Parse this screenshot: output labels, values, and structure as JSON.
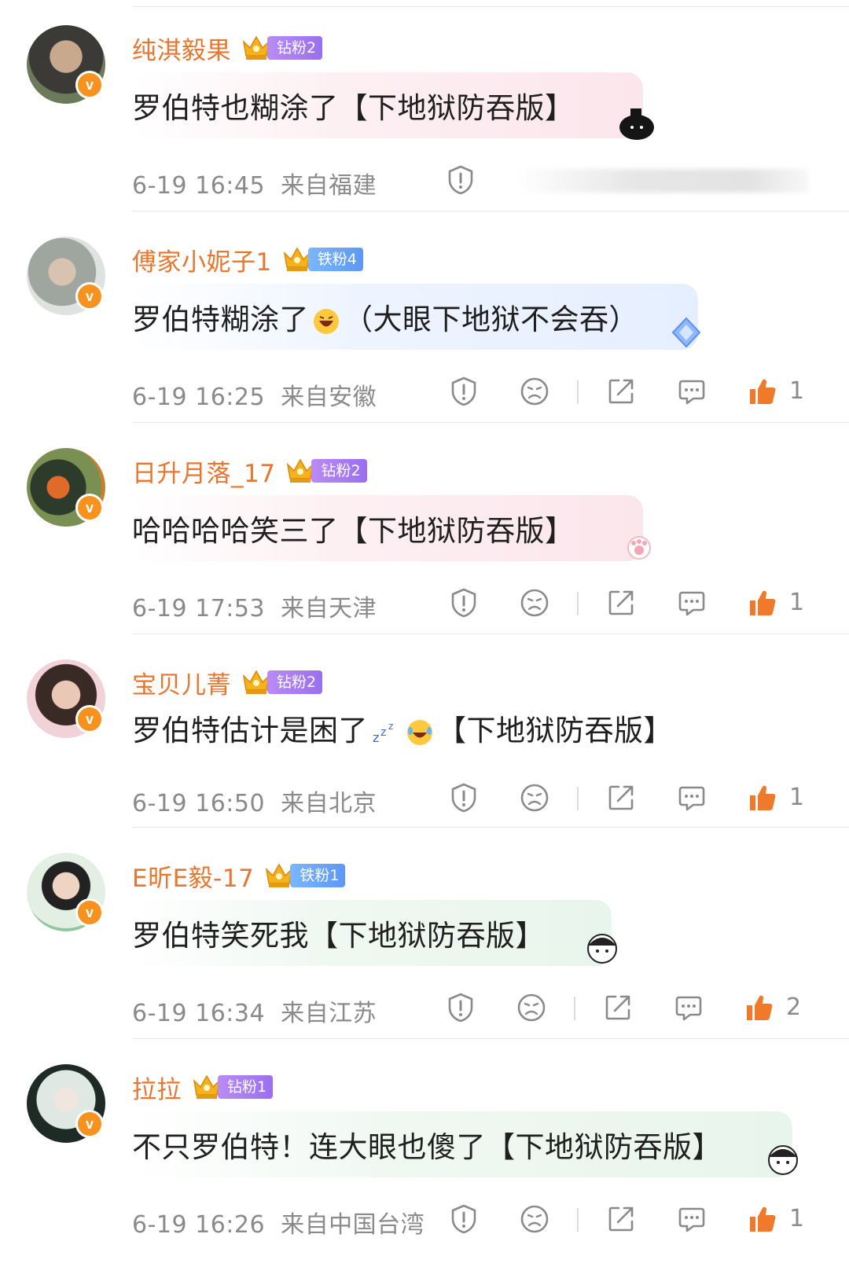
{
  "comments": [
    {
      "username": "纯淇毅果",
      "fan_badge": "钻粉2",
      "text": "罗伯特也糊涂了【下地狱防吞版】",
      "time": "6-19 16:45",
      "location": "来自福建",
      "likes": ""
    },
    {
      "username": "傅家小妮子1",
      "fan_badge": "铁粉4",
      "text_a": "罗伯特糊涂了",
      "text_b": "（大眼下地狱不会吞）",
      "time": "6-19 16:25",
      "location": "来自安徽",
      "likes": "1"
    },
    {
      "username": "日升月落_17",
      "fan_badge": "钻粉2",
      "text": "哈哈哈哈笑三了【下地狱防吞版】",
      "time": "6-19 17:53",
      "location": "来自天津",
      "likes": "1"
    },
    {
      "username": "宝贝儿菁",
      "fan_badge": "钻粉2",
      "text_a": "罗伯特估计是困了",
      "text_b": "【下地狱防吞版】",
      "time": "6-19 16:50",
      "location": "来自北京",
      "likes": "1"
    },
    {
      "username": "E昕E毅-17",
      "fan_badge": "铁粉1",
      "text": "罗伯特笑死我【下地狱防吞版】",
      "time": "6-19 16:34",
      "location": "来自江苏",
      "likes": "2"
    },
    {
      "username": "拉拉",
      "fan_badge": "钻粉1",
      "text": "不只罗伯特！连大眼也傻了【下地狱防吞版】",
      "time": "6-19 16:26",
      "location": "来自中国台湾",
      "likes": "1"
    }
  ],
  "colors": {
    "username": "#e8762e",
    "like_active": "#f07a2a",
    "meta_text": "#8a8a8a",
    "verified_badge": "#f7921e"
  },
  "icons": [
    "report-icon",
    "dislike-icon",
    "share-icon",
    "reply-icon",
    "like-icon",
    "crown-icon",
    "verified-icon"
  ]
}
